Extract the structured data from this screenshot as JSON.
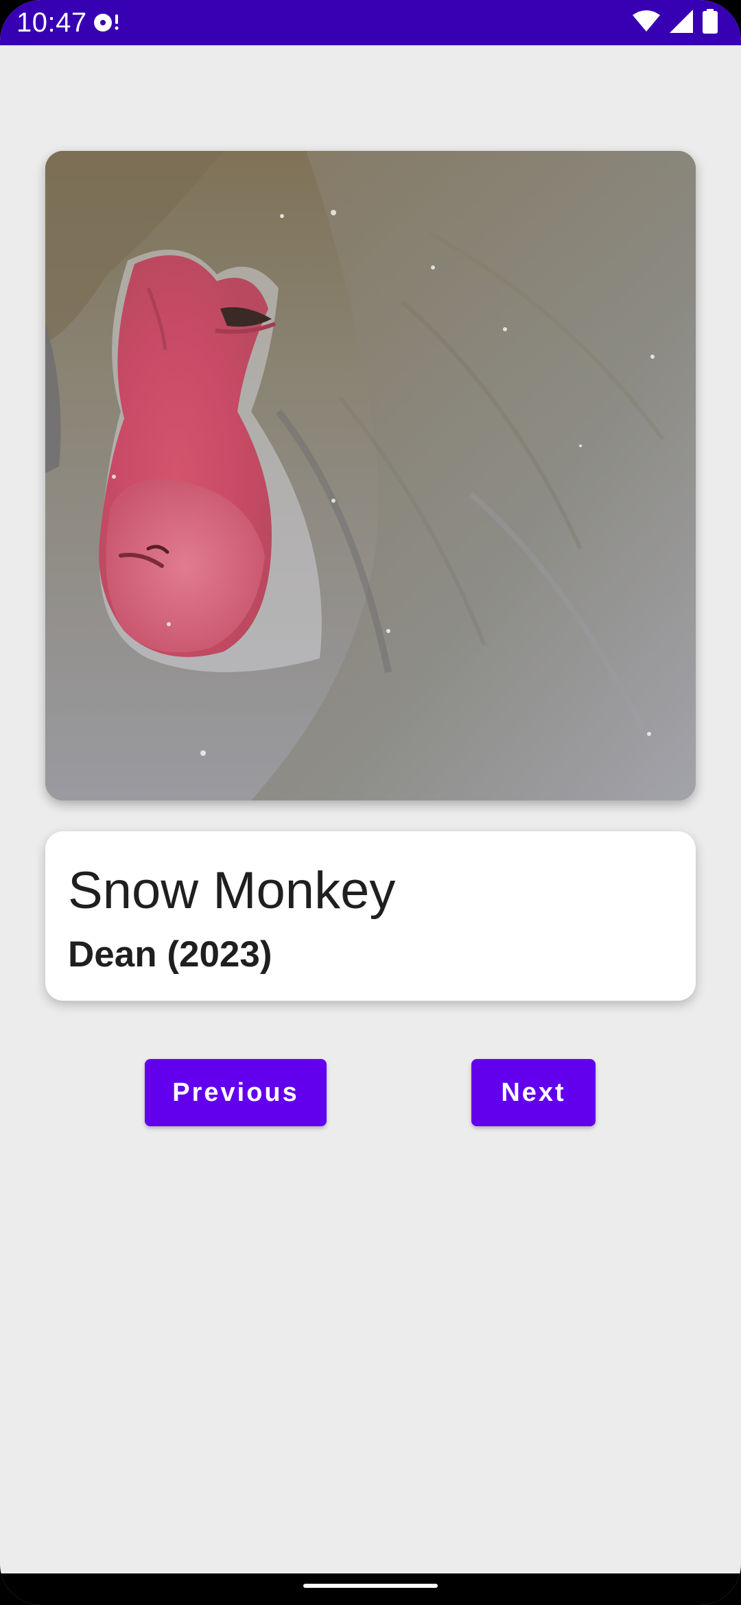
{
  "status_bar": {
    "time": "10:47",
    "icons": [
      "media-disc-icon",
      "wifi-icon",
      "cellular-signal-icon",
      "battery-icon"
    ],
    "background": "#3700b3"
  },
  "gallery": {
    "image_alt": "Snow monkey face close-up",
    "title": "Snow Monkey",
    "artist_year": "Dean (2023)"
  },
  "buttons": {
    "previous_label": "Previous",
    "next_label": "Next",
    "color": "#6200ee"
  },
  "colors": {
    "screen_background": "#ececec",
    "card_background": "#ffffff"
  }
}
